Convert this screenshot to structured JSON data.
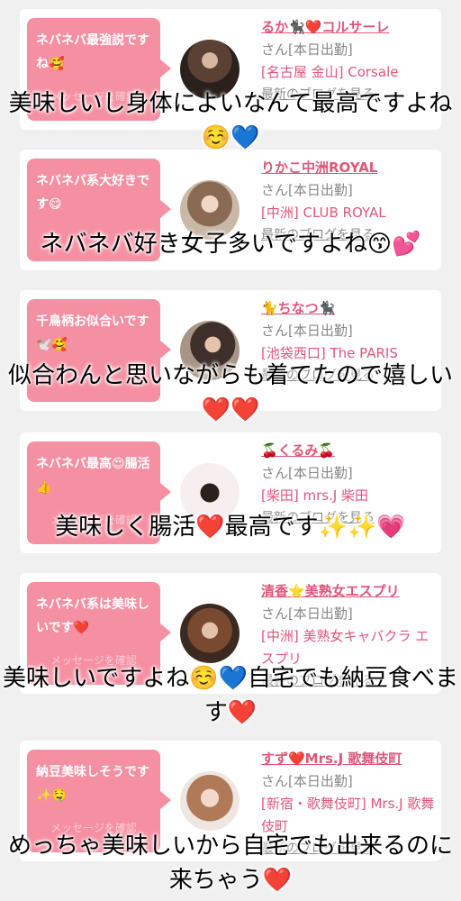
{
  "cards": [
    {
      "bubble": "ネバネバ最強説ですね🥰",
      "bubble_sub": "メッセージを確認",
      "name": "るか🐈‍⬛❤️コルサーレ",
      "suffix": "さん[本日出勤]",
      "place": "[名古屋 金山] Corsale",
      "blog": "最新のブログを見る",
      "caption": "美味しいし身体によいなんて最高ですよね☺️💙"
    },
    {
      "bubble": "ネバネバ系大好きです😋",
      "bubble_sub": "",
      "name": "りかこ中洲ROYAL",
      "suffix": "さん[本日出勤]",
      "place": "[中洲] CLUB ROYAL",
      "blog": "最新のブログを見る",
      "caption": "ネバネバ好き女子多いですよね😙💕"
    },
    {
      "bubble": "千鳥柄お似合いです🕊️🥰",
      "bubble_sub": "",
      "name": "🐈ちなつ🐈‍⬛",
      "suffix": "さん[本日出勤]",
      "place": "[池袋西口] The PARIS",
      "blog": "最新のブログを見る",
      "caption": "似合わんと思いながらも着てたので嬉しい❤️❤️"
    },
    {
      "bubble": "ネバネバ最高😍腸活👍",
      "bubble_sub": "メッセージを確認",
      "name": "🍒くるみ🍒",
      "suffix": "さん[本日出勤]",
      "place": "[柴田] mrs.J 柴田",
      "blog": "最新のブログを見る",
      "caption": "美味しく腸活❤️最高です✨✨💗"
    },
    {
      "bubble": "ネバネバ系は美味しいです❤️",
      "bubble_sub": "メッセージを確認",
      "name": "清香⭐美熟女エスプリ",
      "suffix": "さん[本日出勤]",
      "place": "[中洲] 美熟女キャバクラ エスプリ",
      "blog": "最新のブログを見る",
      "caption": "美味しいですよね☺️💙自宅でも納豆食べます❤️"
    },
    {
      "bubble": "納豆美味しそうです✨🤤",
      "bubble_sub": "メッセージを確認",
      "name": "すず❤️Mrs.J 歌舞伎町",
      "suffix": "さん[本日出勤]",
      "place": "[新宿・歌舞伎町] Mrs.J 歌舞伎町",
      "blog": "最新のブログを見る",
      "caption": "めっちゃ美味しいから自宅でも出来るのに来ちゃう❤️"
    }
  ]
}
